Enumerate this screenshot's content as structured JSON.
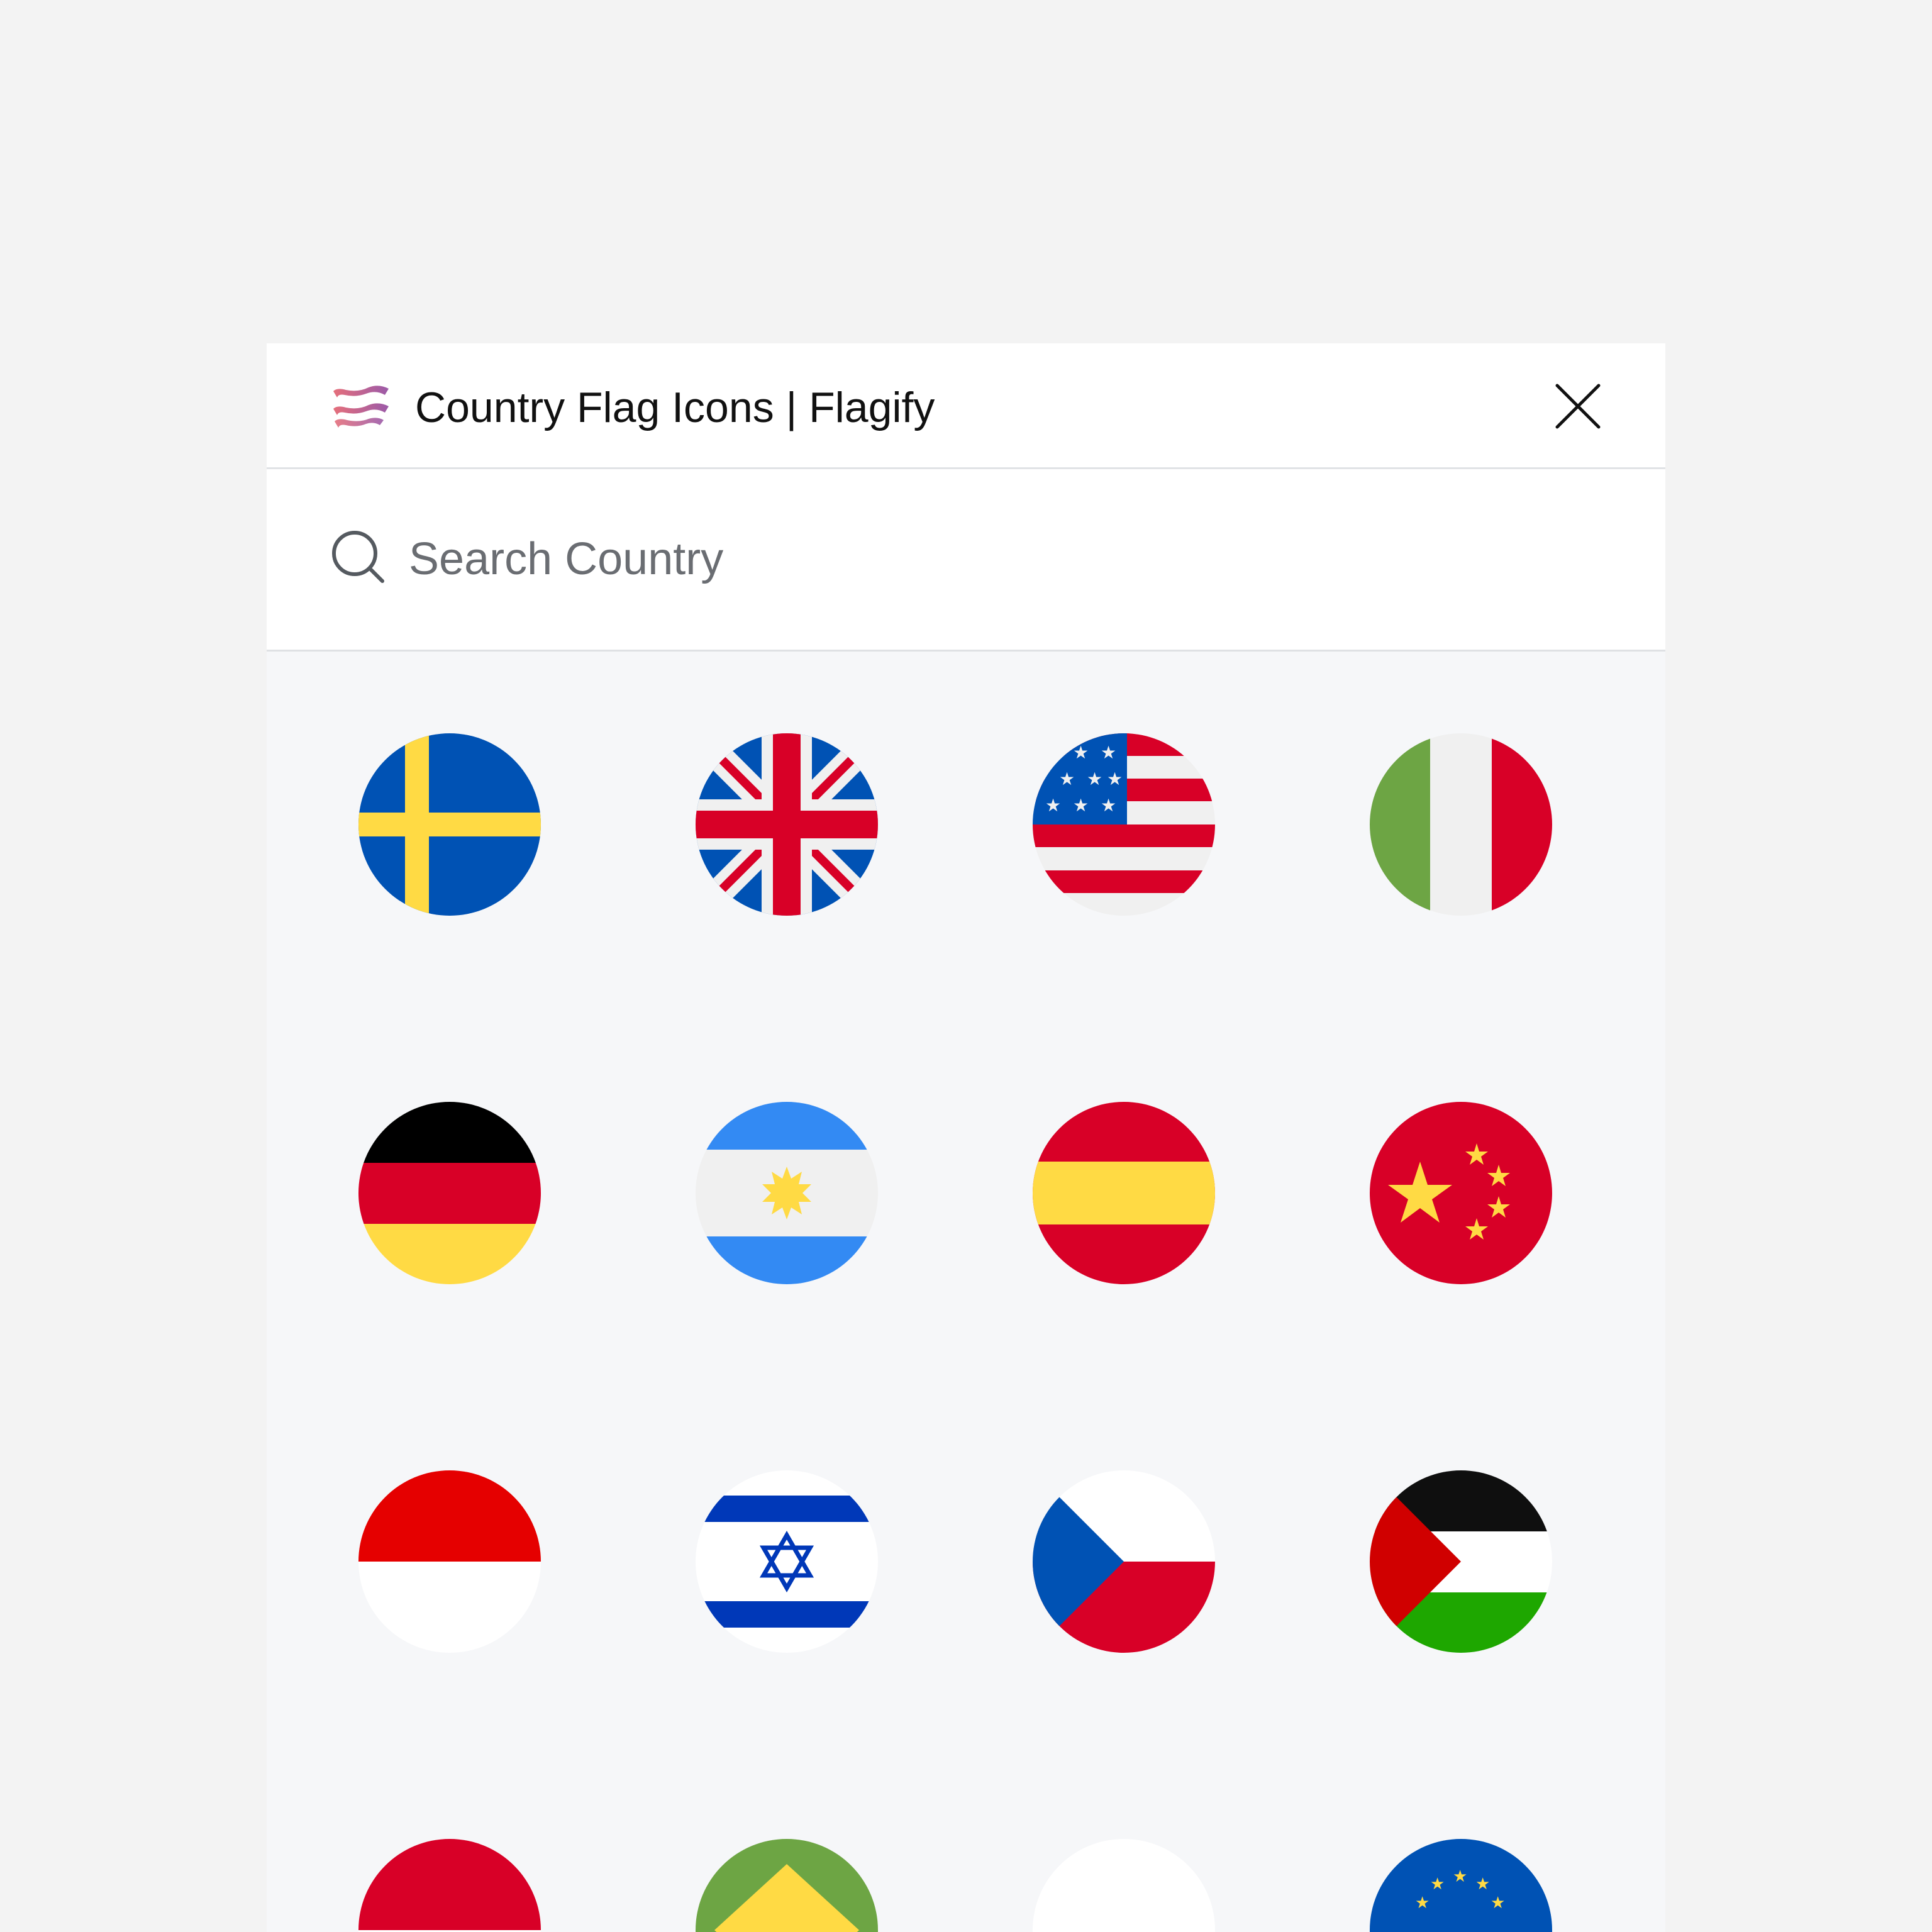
{
  "header": {
    "title": "Country Flag Icons | Flagify",
    "logo_icon": "flagify-wave-logo",
    "close_icon": "close-icon"
  },
  "search": {
    "placeholder": "Search Country",
    "value": "",
    "icon": "search-icon"
  },
  "flags": [
    {
      "id": "sweden",
      "icon": "sweden-flag-icon"
    },
    {
      "id": "united-kingdom",
      "icon": "united-kingdom-flag-icon"
    },
    {
      "id": "united-states",
      "icon": "united-states-flag-icon"
    },
    {
      "id": "italy",
      "icon": "italy-flag-icon"
    },
    {
      "id": "germany",
      "icon": "germany-flag-icon"
    },
    {
      "id": "argentina",
      "icon": "argentina-flag-icon"
    },
    {
      "id": "spain",
      "icon": "spain-flag-icon"
    },
    {
      "id": "china",
      "icon": "china-flag-icon"
    },
    {
      "id": "indonesia",
      "icon": "indonesia-flag-icon"
    },
    {
      "id": "israel",
      "icon": "israel-flag-icon"
    },
    {
      "id": "czech-republic",
      "icon": "czech-republic-flag-icon"
    },
    {
      "id": "palestine",
      "icon": "palestine-flag-icon"
    },
    {
      "id": "red-white-partial",
      "icon": "red-flag-icon"
    },
    {
      "id": "green-partial",
      "icon": "green-flag-icon"
    },
    {
      "id": "white-partial",
      "icon": "white-flag-icon"
    },
    {
      "id": "european-union",
      "icon": "european-union-flag-icon"
    }
  ],
  "colors": {
    "page_background": "#f3f3f3",
    "panel_background": "#f6f7f9",
    "header_background": "#ffffff",
    "divider": "#e1e3e6",
    "title_text": "#111111",
    "placeholder_text": "#6a6d72",
    "logo_gradient_start": "#e56f7b",
    "logo_gradient_end": "#9b5aa8"
  }
}
